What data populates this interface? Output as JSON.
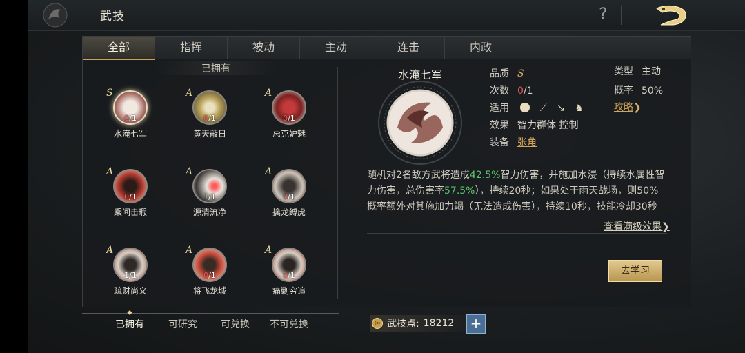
{
  "header": {
    "title": "武技",
    "help_icon": "question-icon",
    "back_icon": "dragon-back-icon"
  },
  "tabs": [
    "全部",
    "指挥",
    "被动",
    "主动",
    "连击",
    "内政"
  ],
  "owned_header": "已拥有",
  "skills": [
    {
      "name": "水淹七军",
      "grade": "S",
      "count_have": "0",
      "count_total": "/1"
    },
    {
      "name": "黄天蔽日",
      "grade": "A",
      "count_have": "0",
      "count_total": "/1"
    },
    {
      "name": "忌克妒魅",
      "grade": "A",
      "count_have": "0",
      "count_total": "/1"
    },
    {
      "name": "乘间击瑕",
      "grade": "A",
      "count_have": "0",
      "count_total": "/1"
    },
    {
      "name": "源清流净",
      "grade": "A",
      "count_have": "1",
      "count_total": "/1"
    },
    {
      "name": "擒龙缚虎",
      "grade": "A",
      "count_have": "0",
      "count_total": "/1"
    },
    {
      "name": "疏财尚义",
      "grade": "A",
      "count_have": "1",
      "count_total": "/1"
    },
    {
      "name": "将飞龙城",
      "grade": "A",
      "count_have": "0",
      "count_total": "/1"
    },
    {
      "name": "痛剿穷追",
      "grade": "A",
      "count_have": "0",
      "count_total": "/1"
    }
  ],
  "detail": {
    "name": "水淹七军",
    "quality_label": "品质",
    "quality": "S",
    "times_label": "次数",
    "times_have": "0",
    "times_total": "/1",
    "apply_label": "适用",
    "effect_label": "效果",
    "effect": "智力群体 控制",
    "equip_label": "装备",
    "equip": "张角",
    "type_label": "类型",
    "type": "主动",
    "rate_label": "概率",
    "rate": "50%",
    "guide": "攻略",
    "desc_1": "随机对2名敌方武将造成",
    "desc_pct1": "42.5%",
    "desc_2": "智力伤害，并施加水浸（持续水属性智力伤害，总伤害率",
    "desc_pct2": "57.5%",
    "desc_3": "），持续20秒；如果处于雨天战场，则50%概率额外对其施加力竭（无法造成伤害），持续10秒，技能冷却30秒",
    "more": "查看满级效果",
    "learn": "去学习"
  },
  "subtabs": [
    "已拥有",
    "可研究",
    "可兑换",
    "不可兑换"
  ],
  "points": {
    "label": "武技点:",
    "value": "18212"
  }
}
